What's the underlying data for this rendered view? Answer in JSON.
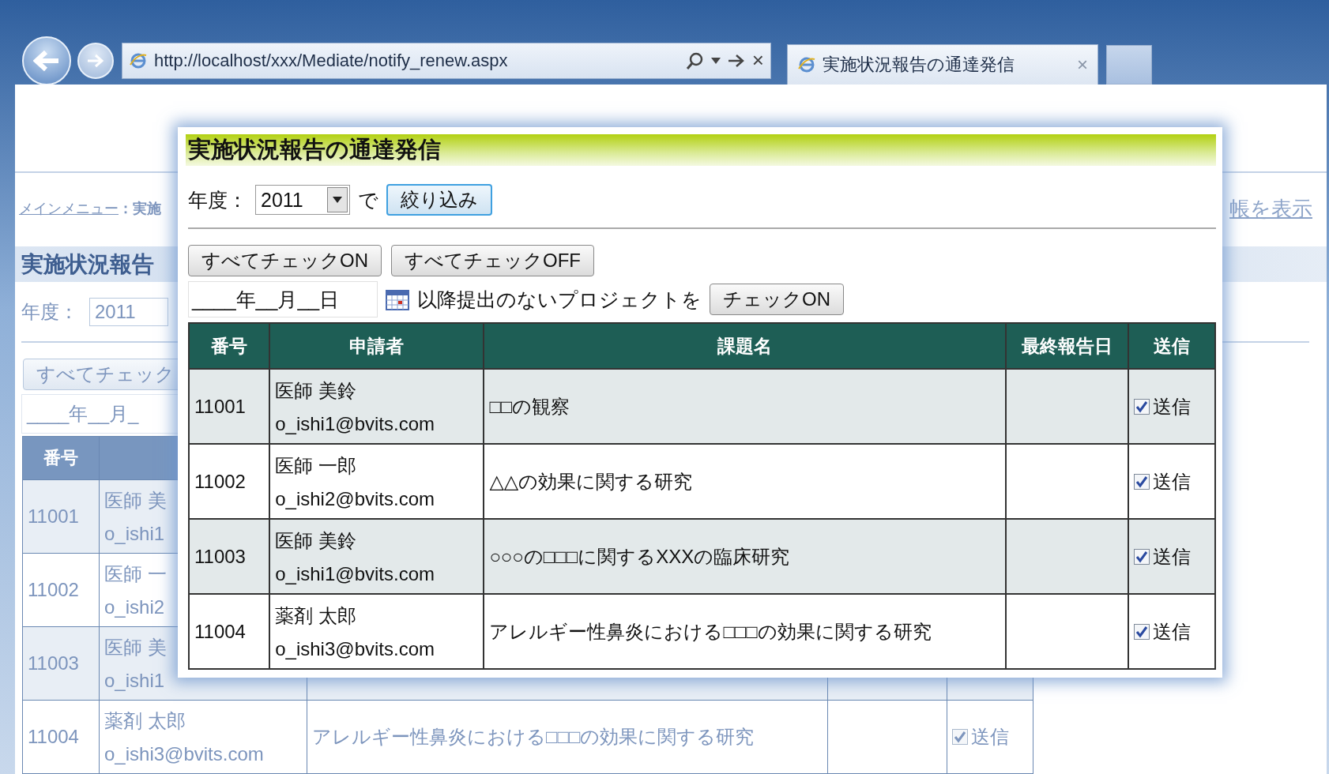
{
  "browser": {
    "url": "http://localhost/xxx/Mediate/notify_renew.aspx",
    "address_close": "×",
    "tab_title": "実施状況報告の通達発信",
    "tab_close": "×"
  },
  "page": {
    "breadcrumb_link": "メインメニュー",
    "breadcrumb_rest": "：実施",
    "right_link": "帳を表示",
    "title": "実施状況報告",
    "year_label": "年度：",
    "year_value": "2011",
    "check_button": "すべてチェック",
    "date_field": "____年__月_",
    "table": {
      "columns": [
        "番号"
      ],
      "rows": [
        {
          "number": "11001",
          "applicant": "医師 美",
          "email": "o_ishi1"
        },
        {
          "number": "11002",
          "applicant": "医師 一",
          "email": "o_ishi2"
        },
        {
          "number": "11003",
          "applicant": "医師 美",
          "email": "o_ishi1"
        },
        {
          "number": "11004",
          "applicant": "薬剤 太郎",
          "email": "o_ishi3@bvits.com",
          "title": "アレルギー性鼻炎における□□□の効果に関する研究",
          "send_checked": true,
          "send_label": "送信"
        }
      ]
    }
  },
  "dialog": {
    "title": "実施状況報告の通達発信",
    "year_label": "年度：",
    "year_value": "2011",
    "year_suffix": "で",
    "filter_button": "絞り込み",
    "check_all_on": "すべてチェックON",
    "check_all_off": "すべてチェックOFF",
    "date_field": "____年__月__日",
    "date_suffix": "以降提出のないプロジェクトを",
    "check_on_button": "チェックON",
    "table": {
      "columns": [
        "番号",
        "申請者",
        "課題名",
        "最終報告日",
        "送信"
      ],
      "rows": [
        {
          "number": "11001",
          "applicant": "医師 美鈴",
          "email": "o_ishi1@bvits.com",
          "title": "□□の観察",
          "send_checked": true,
          "send_label": "送信"
        },
        {
          "number": "11002",
          "applicant": "医師 一郎",
          "email": "o_ishi2@bvits.com",
          "title": "△△の効果に関する研究",
          "send_checked": true,
          "send_label": "送信"
        },
        {
          "number": "11003",
          "applicant": "医師 美鈴",
          "email": "o_ishi1@bvits.com",
          "title": "○○○の□□□に関するXXXの臨床研究",
          "send_checked": true,
          "send_label": "送信"
        },
        {
          "number": "11004",
          "applicant": "薬剤 太郎",
          "email": "o_ishi3@bvits.com",
          "title": "アレルギー性鼻炎における□□□の効果に関する研究",
          "send_checked": true,
          "send_label": "送信"
        }
      ]
    }
  }
}
